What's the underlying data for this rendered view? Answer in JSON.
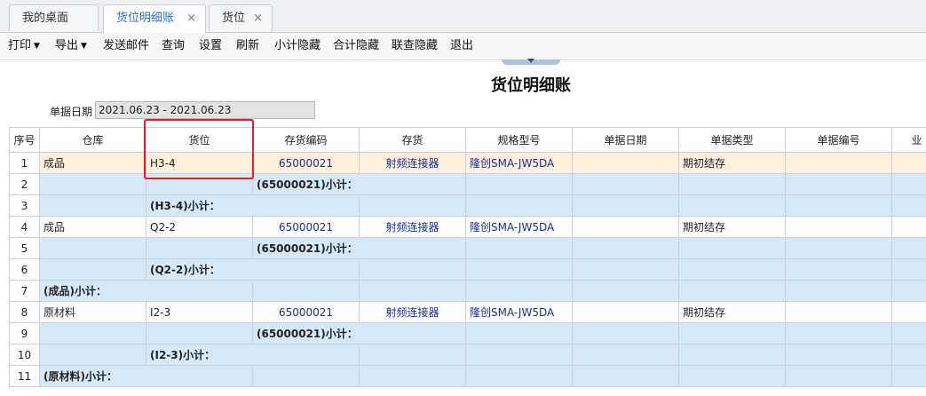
{
  "tabs": [
    {
      "label": "我的桌面",
      "closable": false
    },
    {
      "label": "货位明细账",
      "closable": true,
      "active": true
    },
    {
      "label": "货位",
      "closable": true
    }
  ],
  "toolbar": {
    "print": "打印",
    "export": "导出",
    "send_mail": "发送邮件",
    "query": "查询",
    "settings": "设置",
    "refresh": "刷新",
    "hide_subtotal": "小计隐藏",
    "hide_total": "合计隐藏",
    "hide_linked": "联查隐藏",
    "exit": "退出"
  },
  "report": {
    "title": "货位明细账",
    "date_label": "单据日期",
    "date_value": "2021.06.23 - 2021.06.23"
  },
  "columns": [
    "序号",
    "仓库",
    "货位",
    "存货编码",
    "存货",
    "规格型号",
    "单据日期",
    "单据类型",
    "单据编号",
    "业"
  ],
  "rows": [
    {
      "seq": "1",
      "warehouse": "成品",
      "location": "H3-4",
      "code": "65000021",
      "inventory": "射频连接器",
      "spec": "隆创SMA-JW5DA",
      "date": "",
      "type": "期初结存",
      "number": ""
    },
    {
      "seq": "2",
      "code_subtotal": "(65000021)小计："
    },
    {
      "seq": "3",
      "location_subtotal": "(H3-4)小计："
    },
    {
      "seq": "4",
      "warehouse": "成品",
      "location": "Q2-2",
      "code": "65000021",
      "inventory": "射频连接器",
      "spec": "隆创SMA-JW5DA",
      "date": "",
      "type": "期初结存",
      "number": ""
    },
    {
      "seq": "5",
      "code_subtotal": "(65000021)小计："
    },
    {
      "seq": "6",
      "location_subtotal": "(Q2-2)小计："
    },
    {
      "seq": "7",
      "warehouse_subtotal": "(成品)小计："
    },
    {
      "seq": "8",
      "warehouse": "原材料",
      "location": "I2-3",
      "code": "65000021",
      "inventory": "射频连接器",
      "spec": "隆创SMA-JW5DA",
      "date": "",
      "type": "期初结存",
      "number": ""
    },
    {
      "seq": "9",
      "code_subtotal": "(65000021)小计："
    },
    {
      "seq": "10",
      "location_subtotal": "(I2-3)小计："
    },
    {
      "seq": "11",
      "warehouse_subtotal": "(原材料)小计："
    }
  ],
  "icons": {
    "tab_close": "×",
    "dropdown": "▼"
  },
  "colors": {
    "highlight_row": "#fdf0dc",
    "subtotal_row": "#d7e8f6",
    "link_text": "#1b2c98",
    "annotation_box": "#e02323",
    "active_tab_text": "#2a6fd6"
  }
}
